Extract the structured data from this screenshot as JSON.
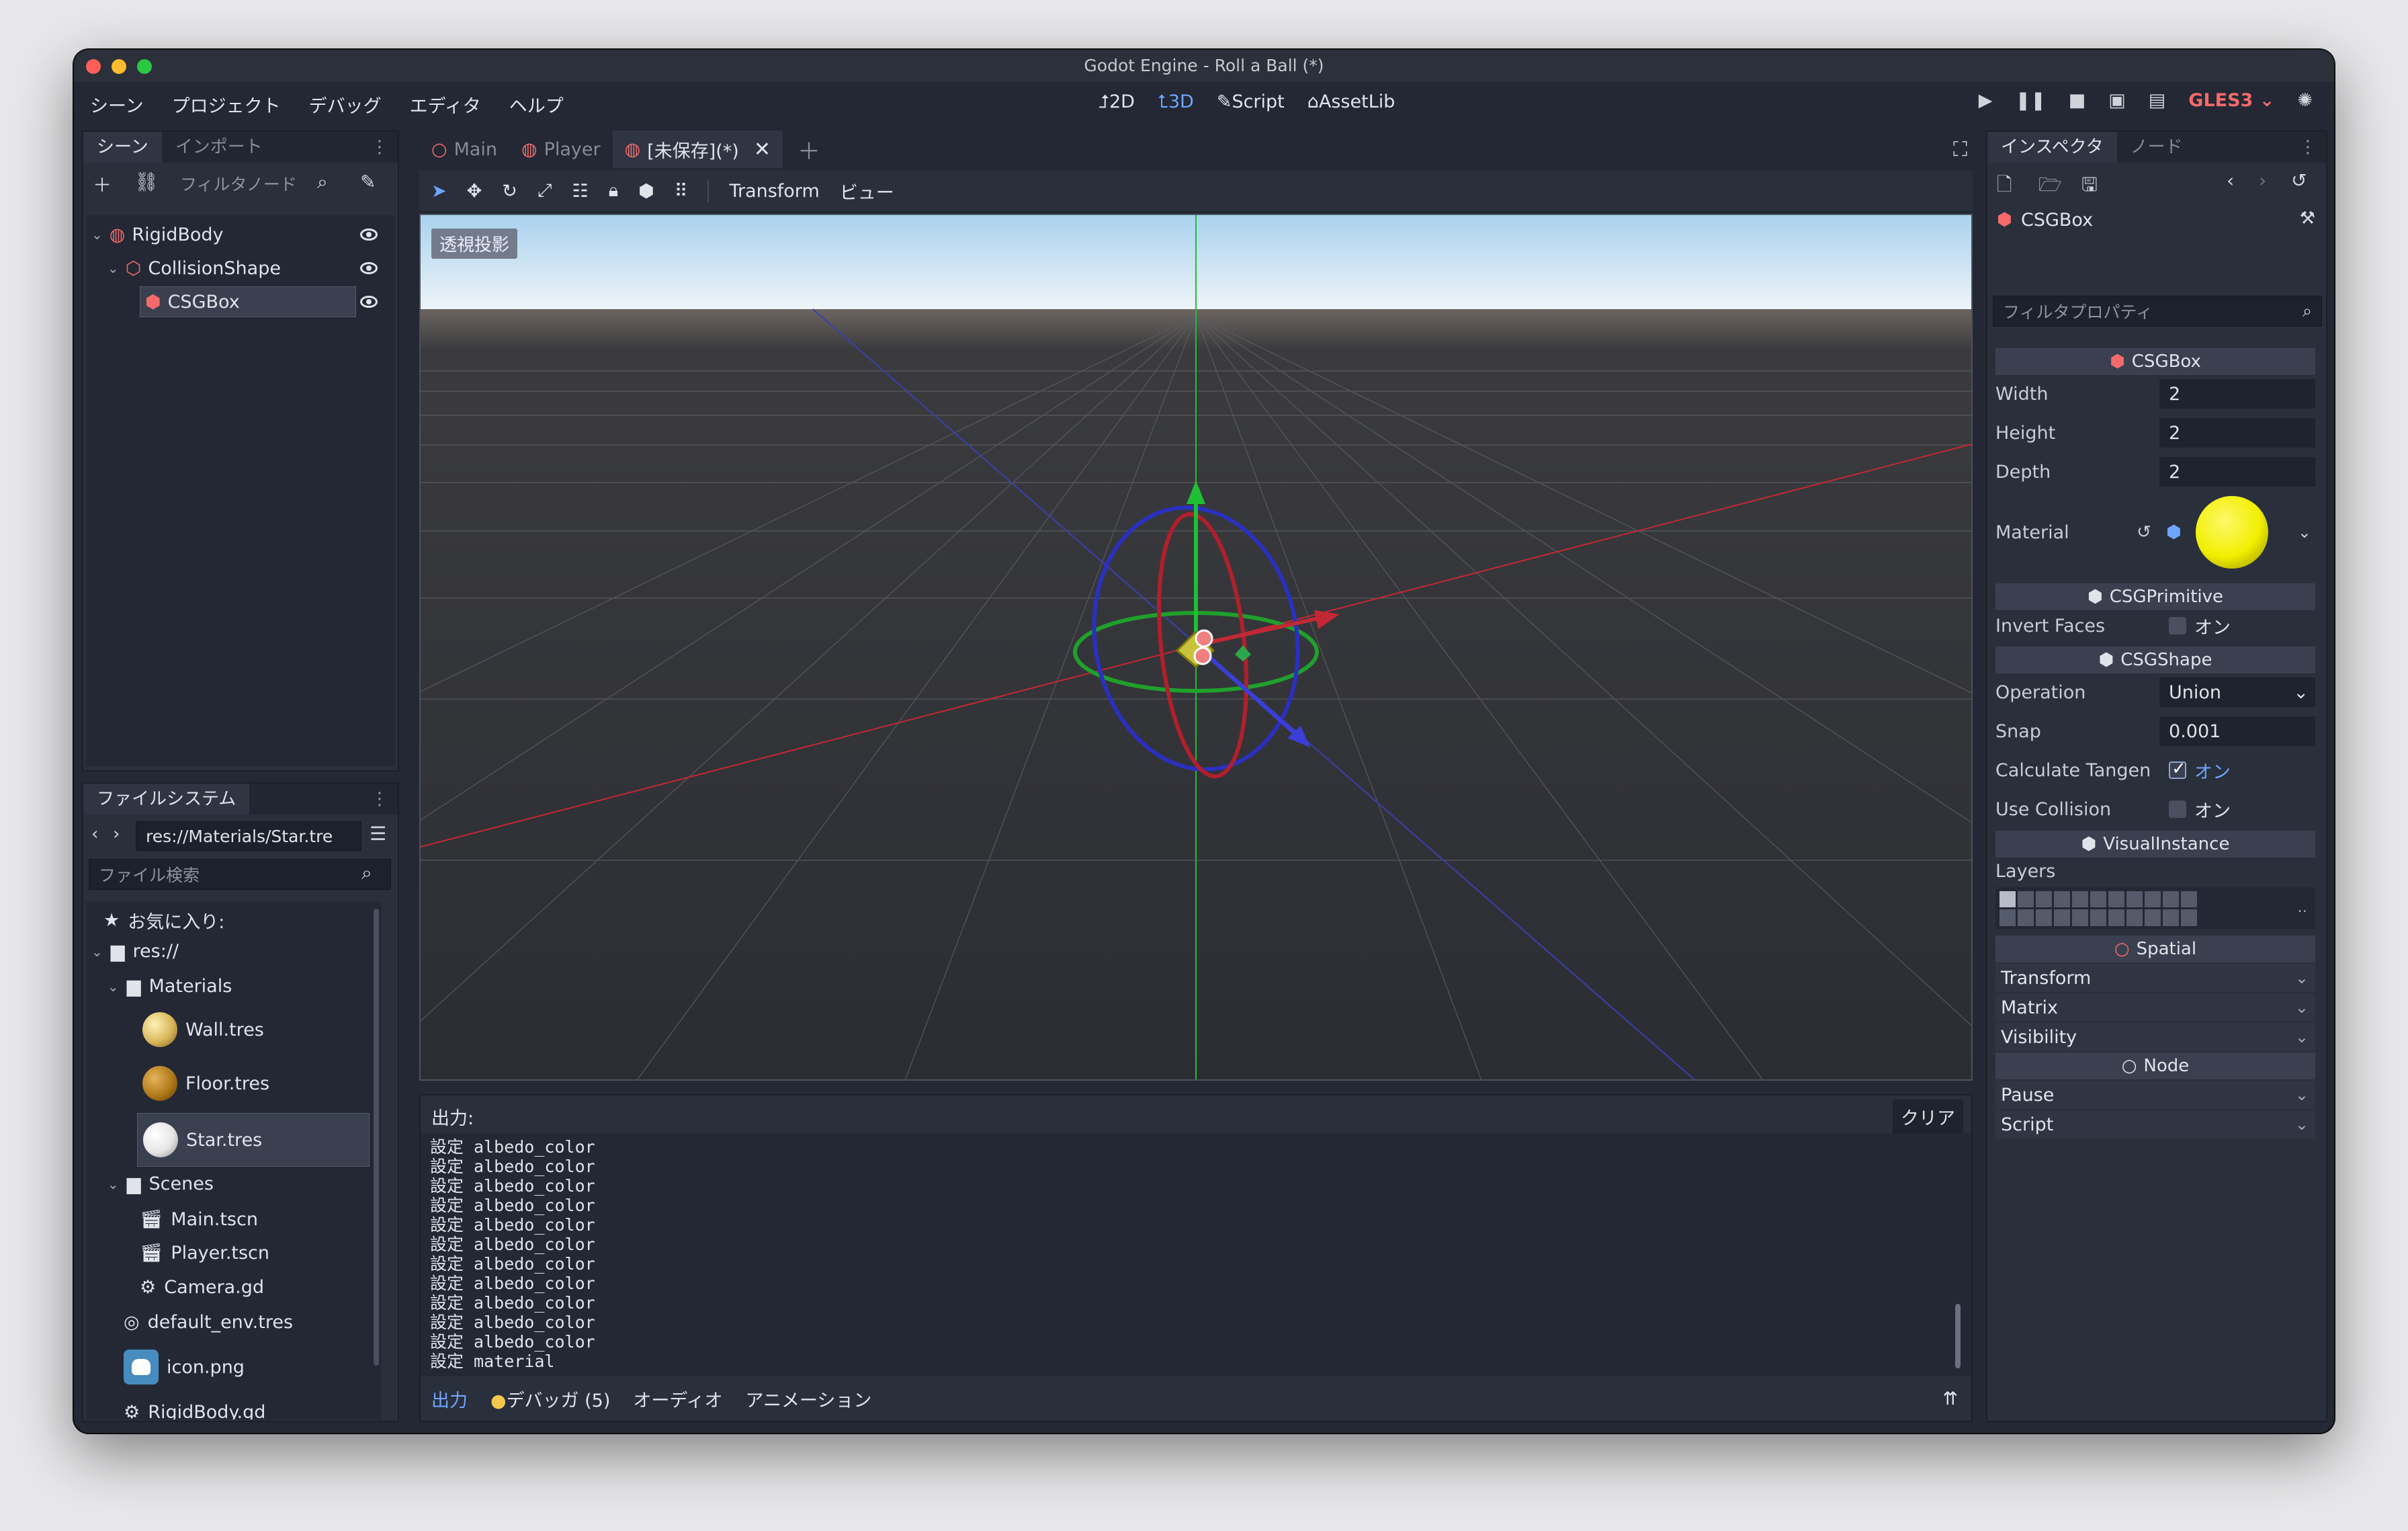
{
  "window": {
    "title": "Godot Engine - Roll a Ball (*)"
  },
  "menu": [
    "シーン",
    "プロジェクト",
    "デバッグ",
    "エディタ",
    "ヘルプ"
  ],
  "modes": [
    {
      "icon": "2d-icon",
      "label": "2D"
    },
    {
      "icon": "3d-icon",
      "label": "3D"
    },
    {
      "icon": "script-icon",
      "label": "Script"
    },
    {
      "icon": "assetlib-icon",
      "label": "AssetLib"
    }
  ],
  "renderer": "GLES3",
  "scene_dock": {
    "tabs": [
      "シーン",
      "インポート"
    ],
    "filter_placeholder": "フィルタノード",
    "nodes": [
      {
        "name": "RigidBody",
        "color": "#f46a6a"
      },
      {
        "name": "CollisionShape",
        "color": "#f46a6a"
      },
      {
        "name": "CSGBox",
        "color": "#f46a6a"
      }
    ]
  },
  "filesystem": {
    "title": "ファイルシステム",
    "path": "res://Materials/Star.tre",
    "search_placeholder": "ファイル検索",
    "favorites": "お気に入り:",
    "root": "res://",
    "items": [
      {
        "name": "Materials",
        "type": "folder"
      },
      {
        "name": "Wall.tres",
        "type": "material",
        "color": "#d9b75a"
      },
      {
        "name": "Floor.tres",
        "type": "material",
        "color": "#b07a1a"
      },
      {
        "name": "Star.tres",
        "type": "material",
        "color": "#eeeeee"
      },
      {
        "name": "Scenes",
        "type": "folder"
      },
      {
        "name": "Main.tscn",
        "type": "scene"
      },
      {
        "name": "Player.tscn",
        "type": "scene"
      },
      {
        "name": "Camera.gd",
        "type": "script"
      },
      {
        "name": "default_env.tres",
        "type": "env"
      },
      {
        "name": "icon.png",
        "type": "image"
      },
      {
        "name": "RigidBody.gd",
        "type": "script"
      }
    ]
  },
  "editor_tabs": [
    "Main",
    "Player",
    "[未保存](*)"
  ],
  "viewport_toolbar": {
    "transform": "Transform",
    "view": "ビュー"
  },
  "viewport": {
    "perspective_label": "透視投影"
  },
  "output": {
    "title": "出力:",
    "clear": "クリア",
    "lines": [
      "設定 albedo_color",
      "設定 albedo_color",
      "設定 albedo_color",
      "設定 albedo_color",
      "設定 albedo_color",
      "設定 albedo_color",
      "設定 albedo_color",
      "設定 albedo_color",
      "設定 albedo_color",
      "設定 albedo_color",
      "設定 albedo_color",
      "設定 material"
    ],
    "bottom_tabs": [
      "出力",
      "デバッガ (5)",
      "オーディオ",
      "アニメーション"
    ]
  },
  "inspector": {
    "tabs": [
      "インスペクタ",
      "ノード"
    ],
    "object": "CSGBox",
    "filter_placeholder": "フィルタプロパティ",
    "sections": {
      "csgbox": "CSGBox",
      "csgprimitive": "CSGPrimitive",
      "csgshape": "CSGShape",
      "visualinstance": "VisualInstance",
      "spatial": "Spatial",
      "node": "Node"
    },
    "width": {
      "label": "Width",
      "value": "2"
    },
    "height": {
      "label": "Height",
      "value": "2"
    },
    "depth": {
      "label": "Depth",
      "value": "2"
    },
    "material": {
      "label": "Material",
      "color": "#f2ef00"
    },
    "invert_faces": {
      "label": "Invert Faces",
      "value": "オン",
      "checked": false
    },
    "operation": {
      "label": "Operation",
      "value": "Union"
    },
    "snap": {
      "label": "Snap",
      "value": "0.001"
    },
    "calc_tangents": {
      "label": "Calculate Tangen",
      "value": "オン",
      "checked": true
    },
    "use_collision": {
      "label": "Use Collision",
      "value": "オン",
      "checked": false
    },
    "layers": "Layers",
    "spatial_props": [
      "Transform",
      "Matrix",
      "Visibility"
    ],
    "node_props": [
      "Pause",
      "Script"
    ]
  },
  "colors": {
    "accent": "#6ea6ff",
    "node_red": "#f46a6a",
    "axis_x": "#d32a3a",
    "axis_y": "#1fbf35",
    "axis_z": "#3a3fd6"
  }
}
